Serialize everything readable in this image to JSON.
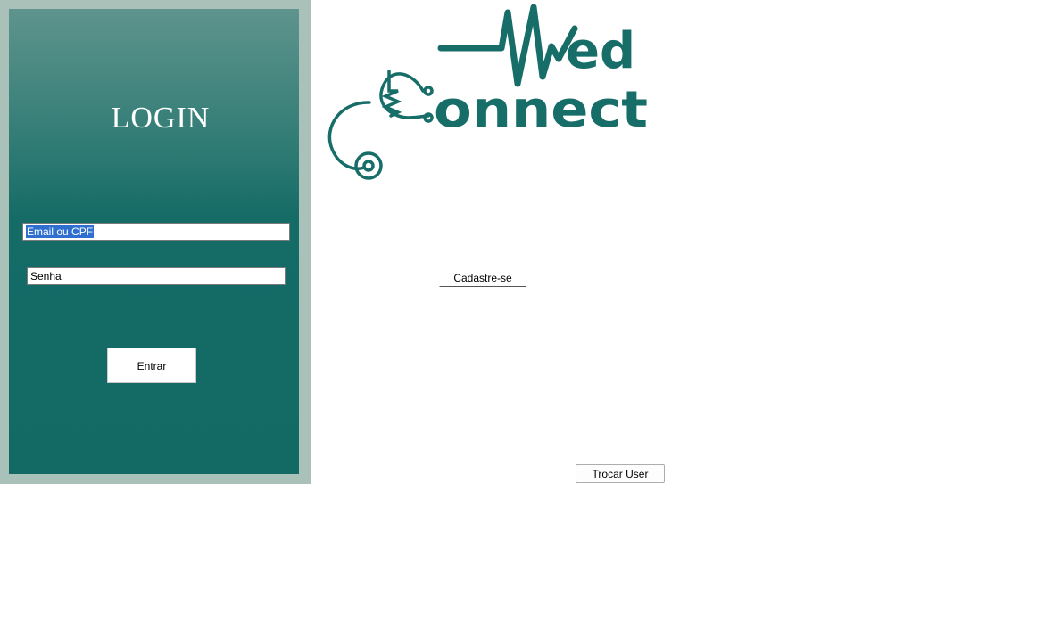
{
  "login_panel": {
    "title": "LOGIN",
    "email_field": {
      "value": "Email ou CPF"
    },
    "password_field": {
      "value": "Senha"
    },
    "submit_label": "Entrar"
  },
  "logo": {
    "line1": "ed",
    "line2": "onnect",
    "color": "#176d68"
  },
  "register_label": "Cadastre-se",
  "switch_user_label": "Trocar User",
  "colors": {
    "panel_frame": "#a9c1b8",
    "panel_top": "#5e948d",
    "panel_bottom": "#136964",
    "selection": "#2f6fd0"
  }
}
